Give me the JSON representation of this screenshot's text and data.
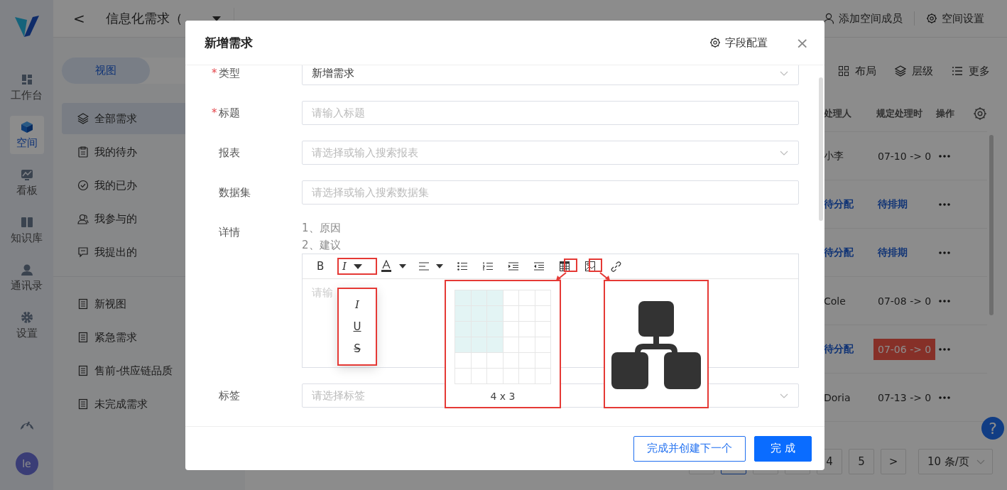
{
  "nav": {
    "items": [
      {
        "label": "工作台",
        "selected": false
      },
      {
        "label": "空间",
        "selected": true
      },
      {
        "label": "看板",
        "selected": false
      },
      {
        "label": "知识库",
        "selected": false
      },
      {
        "label": "通讯录",
        "selected": false
      },
      {
        "label": "设置",
        "selected": false
      }
    ],
    "avatar": "le"
  },
  "header": {
    "back": "<",
    "title": "信息化需求（",
    "actions": [
      "添加空间成员",
      "空间设置"
    ]
  },
  "sidebar": {
    "segments": [
      {
        "label": "视图",
        "selected": true
      }
    ],
    "views": [
      {
        "label": "全部需求",
        "selected": true
      },
      {
        "label": "我的待办",
        "selected": false
      },
      {
        "label": "我的已办",
        "selected": false
      },
      {
        "label": "我参与的",
        "selected": false
      },
      {
        "label": "我提出的",
        "selected": false
      }
    ],
    "custom_views": [
      {
        "label": "新视图",
        "selected": false
      },
      {
        "label": "紧急需求",
        "selected": false
      },
      {
        "label": "售前-供应链品质",
        "selected": false
      },
      {
        "label": "未完成需求",
        "selected": false
      }
    ]
  },
  "toolbar": [
    "布局",
    "层级",
    "更多"
  ],
  "table": {
    "columns": [
      "处理人",
      "规定处理时",
      "操作"
    ],
    "rows": [
      {
        "cells": [
          {
            "text": "小李",
            "kind": "plain"
          },
          {
            "text": "07-10 -> 0",
            "kind": "plain"
          }
        ]
      },
      {
        "cells": [
          {
            "text": "待分配",
            "kind": "link"
          },
          {
            "text": "待排期",
            "kind": "link"
          }
        ]
      },
      {
        "cells": [
          {
            "text": "待分配",
            "kind": "link"
          },
          {
            "text": "待排期",
            "kind": "link"
          }
        ]
      },
      {
        "cells": [
          {
            "text": "Cole",
            "kind": "plain"
          },
          {
            "text": "07-08 -> 0",
            "kind": "plain"
          }
        ]
      },
      {
        "cells": [
          {
            "text": "待分配",
            "kind": "link"
          },
          {
            "text": "07-06 -> 0",
            "kind": "overdue"
          }
        ]
      },
      {
        "cells": [
          {
            "text": "Doria",
            "kind": "plain"
          },
          {
            "text": "07-13 -> 0",
            "kind": "plain"
          }
        ]
      }
    ]
  },
  "pagination": {
    "pages": [
      {
        "selected": false
      },
      {
        "selected": true
      },
      {
        "selected": false
      },
      {
        "selected": false
      },
      {
        "label": "4",
        "selected": false
      },
      {
        "label": "5",
        "selected": false
      }
    ],
    "next": ">",
    "page_size": "10 条/页"
  },
  "help": "?",
  "dialog": {
    "title": "新增需求",
    "config": "字段配置",
    "close": "×",
    "required_mark": "*",
    "fields": [
      {
        "label": "类型",
        "required": true,
        "kind": "select",
        "value": "新增需求"
      },
      {
        "label": "标题",
        "required": true,
        "kind": "input",
        "placeholder": "请输入标题"
      },
      {
        "label": "报表",
        "required": false,
        "kind": "select",
        "placeholder": "请选择或输入搜索报表"
      },
      {
        "label": "数据集",
        "required": false,
        "kind": "input",
        "placeholder": "请选择或输入搜索数据集"
      },
      {
        "label": "详情",
        "required": false,
        "kind": "editor",
        "lines": [
          "1、原因",
          "2、建议"
        ],
        "placeholder": "请输"
      },
      {
        "label": "标签",
        "required": false,
        "kind": "select",
        "placeholder": "请选择标签"
      }
    ],
    "editor_toolbar": [
      {
        "kind": "bold",
        "text": "B"
      },
      {
        "kind": "italic",
        "text": "I"
      },
      {
        "kind": "color"
      },
      {
        "kind": "align"
      },
      {
        "kind": "bullets"
      },
      {
        "kind": "numbers"
      },
      {
        "kind": "indent"
      },
      {
        "kind": "outdent"
      },
      {
        "kind": "table"
      },
      {
        "kind": "image"
      },
      {
        "kind": "link"
      }
    ],
    "style_menu": [
      {
        "kind": "italic",
        "text": "I"
      },
      {
        "kind": "underline",
        "text": "U"
      },
      {
        "kind": "strike",
        "text": "S"
      }
    ],
    "table_picker": {
      "label": "4 x 3",
      "rows": [
        {
          "cells": [
            {
              "selected": true
            },
            {
              "selected": true
            },
            {
              "selected": true
            },
            {
              "selected": false
            },
            {
              "selected": false
            },
            {
              "selected": false
            }
          ]
        },
        {
          "cells": [
            {
              "selected": true
            },
            {
              "selected": true
            },
            {
              "selected": true
            },
            {
              "selected": false
            },
            {
              "selected": false
            },
            {
              "selected": false
            }
          ]
        },
        {
          "cells": [
            {
              "selected": true
            },
            {
              "selected": true
            },
            {
              "selected": true
            },
            {
              "selected": false
            },
            {
              "selected": false
            },
            {
              "selected": false
            }
          ]
        },
        {
          "cells": [
            {
              "selected": true
            },
            {
              "selected": true
            },
            {
              "selected": true
            },
            {
              "selected": false
            },
            {
              "selected": false
            },
            {
              "selected": false
            }
          ]
        },
        {
          "cells": [
            {
              "selected": false
            },
            {
              "selected": false
            },
            {
              "selected": false
            },
            {
              "selected": false
            },
            {
              "selected": false
            },
            {
              "selected": false
            }
          ]
        },
        {
          "cells": [
            {
              "selected": false
            },
            {
              "selected": false
            },
            {
              "selected": false
            },
            {
              "selected": false
            },
            {
              "selected": false
            },
            {
              "selected": false
            }
          ]
        }
      ]
    },
    "buttons": [
      {
        "label": "完成并创建下一个",
        "kind": "secondary"
      },
      {
        "label": "完 成",
        "kind": "primary"
      }
    ]
  }
}
